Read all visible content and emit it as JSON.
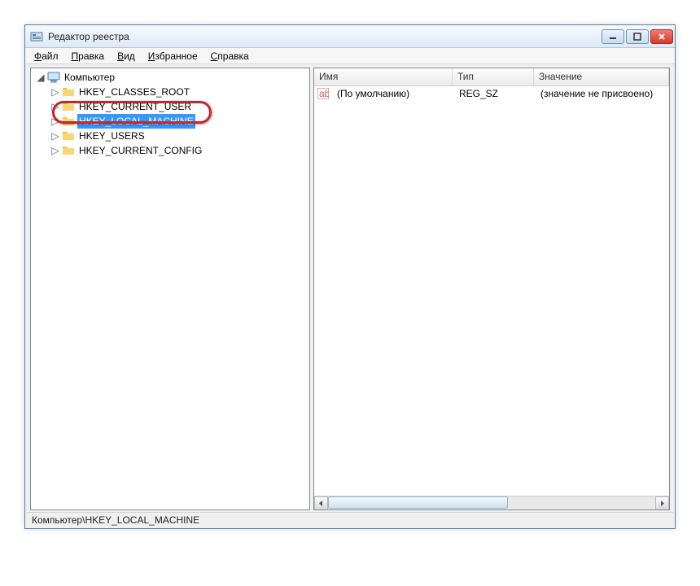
{
  "window": {
    "title": "Редактор реестра"
  },
  "menubar": [
    {
      "accel": "Ф",
      "rest": "айл"
    },
    {
      "accel": "П",
      "rest": "равка"
    },
    {
      "accel": "В",
      "rest": "ид"
    },
    {
      "accel": "И",
      "rest": "збранное"
    },
    {
      "accel": "С",
      "rest": "правка"
    }
  ],
  "tree": {
    "root": "Компьютер",
    "items": [
      {
        "label": "HKEY_CLASSES_ROOT"
      },
      {
        "label": "HKEY_CURRENT_USER"
      },
      {
        "label": "HKEY_LOCAL_MACHINE",
        "selected": true
      },
      {
        "label": "HKEY_USERS"
      },
      {
        "label": "HKEY_CURRENT_CONFIG"
      }
    ]
  },
  "list": {
    "columns": {
      "name": "Имя",
      "type": "Тип",
      "value": "Значение"
    },
    "rows": [
      {
        "name": "(По умолчанию)",
        "type": "REG_SZ",
        "value": "(значение не присвоено)"
      }
    ]
  },
  "statusbar": {
    "path": "Компьютер\\HKEY_LOCAL_MACHINE"
  }
}
